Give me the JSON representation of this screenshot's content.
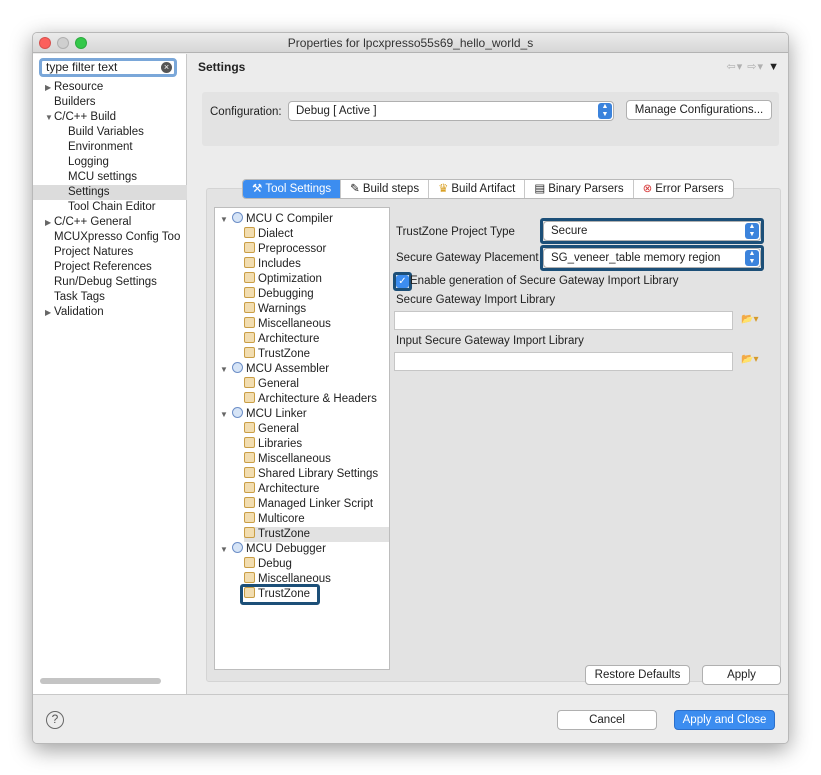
{
  "window": {
    "title": "Properties for lpcxpresso55s69_hello_world_s"
  },
  "filter": {
    "value": "type filter text"
  },
  "nav": {
    "items": [
      {
        "label": "Resource",
        "indent": 0,
        "twisty": "▶"
      },
      {
        "label": "Builders",
        "indent": 0,
        "twisty": ""
      },
      {
        "label": "C/C++ Build",
        "indent": 0,
        "twisty": "▼"
      },
      {
        "label": "Build Variables",
        "indent": 1,
        "twisty": ""
      },
      {
        "label": "Environment",
        "indent": 1,
        "twisty": ""
      },
      {
        "label": "Logging",
        "indent": 1,
        "twisty": ""
      },
      {
        "label": "MCU settings",
        "indent": 1,
        "twisty": ""
      },
      {
        "label": "Settings",
        "indent": 1,
        "twisty": "",
        "selected": true
      },
      {
        "label": "Tool Chain Editor",
        "indent": 1,
        "twisty": ""
      },
      {
        "label": "C/C++ General",
        "indent": 0,
        "twisty": "▶"
      },
      {
        "label": "MCUXpresso Config Too",
        "indent": 0,
        "twisty": ""
      },
      {
        "label": "Project Natures",
        "indent": 0,
        "twisty": ""
      },
      {
        "label": "Project References",
        "indent": 0,
        "twisty": ""
      },
      {
        "label": "Run/Debug Settings",
        "indent": 0,
        "twisty": ""
      },
      {
        "label": "Task Tags",
        "indent": 0,
        "twisty": ""
      },
      {
        "label": "Validation",
        "indent": 0,
        "twisty": "▶"
      }
    ]
  },
  "page": {
    "title": "Settings"
  },
  "configuration": {
    "label": "Configuration:",
    "value": "Debug  [ Active ]",
    "manage_button": "Manage Configurations..."
  },
  "tabs": [
    {
      "label": "Tool Settings",
      "icon": "tool-settings-icon",
      "active": true
    },
    {
      "label": "Build steps",
      "icon": "build-steps-icon"
    },
    {
      "label": "Build Artifact",
      "icon": "build-artifact-icon"
    },
    {
      "label": "Binary Parsers",
      "icon": "binary-parsers-icon"
    },
    {
      "label": "Error Parsers",
      "icon": "error-parsers-icon"
    }
  ],
  "tree": [
    {
      "label": "MCU C Compiler",
      "type": "group"
    },
    {
      "label": "Dialect",
      "type": "tool"
    },
    {
      "label": "Preprocessor",
      "type": "tool"
    },
    {
      "label": "Includes",
      "type": "tool"
    },
    {
      "label": "Optimization",
      "type": "tool"
    },
    {
      "label": "Debugging",
      "type": "tool"
    },
    {
      "label": "Warnings",
      "type": "tool"
    },
    {
      "label": "Miscellaneous",
      "type": "tool"
    },
    {
      "label": "Architecture",
      "type": "tool"
    },
    {
      "label": "TrustZone",
      "type": "tool"
    },
    {
      "label": "MCU Assembler",
      "type": "group"
    },
    {
      "label": "General",
      "type": "tool"
    },
    {
      "label": "Architecture & Headers",
      "type": "tool"
    },
    {
      "label": "MCU Linker",
      "type": "group"
    },
    {
      "label": "General",
      "type": "tool"
    },
    {
      "label": "Libraries",
      "type": "tool"
    },
    {
      "label": "Miscellaneous",
      "type": "tool"
    },
    {
      "label": "Shared Library Settings",
      "type": "tool"
    },
    {
      "label": "Architecture",
      "type": "tool"
    },
    {
      "label": "Managed Linker Script",
      "type": "tool"
    },
    {
      "label": "Multicore",
      "type": "tool"
    },
    {
      "label": "TrustZone",
      "type": "tool",
      "highlight": true
    },
    {
      "label": "MCU Debugger",
      "type": "group"
    },
    {
      "label": "Debug",
      "type": "tool"
    },
    {
      "label": "Miscellaneous",
      "type": "tool"
    },
    {
      "label": "TrustZone",
      "type": "tool",
      "selected": true
    }
  ],
  "form": {
    "project_type_label": "TrustZone Project Type",
    "project_type_value": "Secure",
    "placement_label": "Secure Gateway Placement",
    "placement_value": "SG_veneer_table memory region",
    "enable_label": "Enable generation of Secure Gateway Import Library",
    "enable_checked": true,
    "import_lib_label": "Secure Gateway Import Library",
    "import_lib_value": "",
    "input_lib_label": "Input Secure Gateway Import Library",
    "input_lib_value": ""
  },
  "buttons": {
    "restore_defaults": "Restore Defaults",
    "apply": "Apply",
    "cancel": "Cancel",
    "apply_and_close": "Apply and Close",
    "help": "?"
  },
  "colors": {
    "accent": "#3c8df0",
    "highlight_border": "#1c4f78",
    "selection": "#dcdcdc"
  }
}
